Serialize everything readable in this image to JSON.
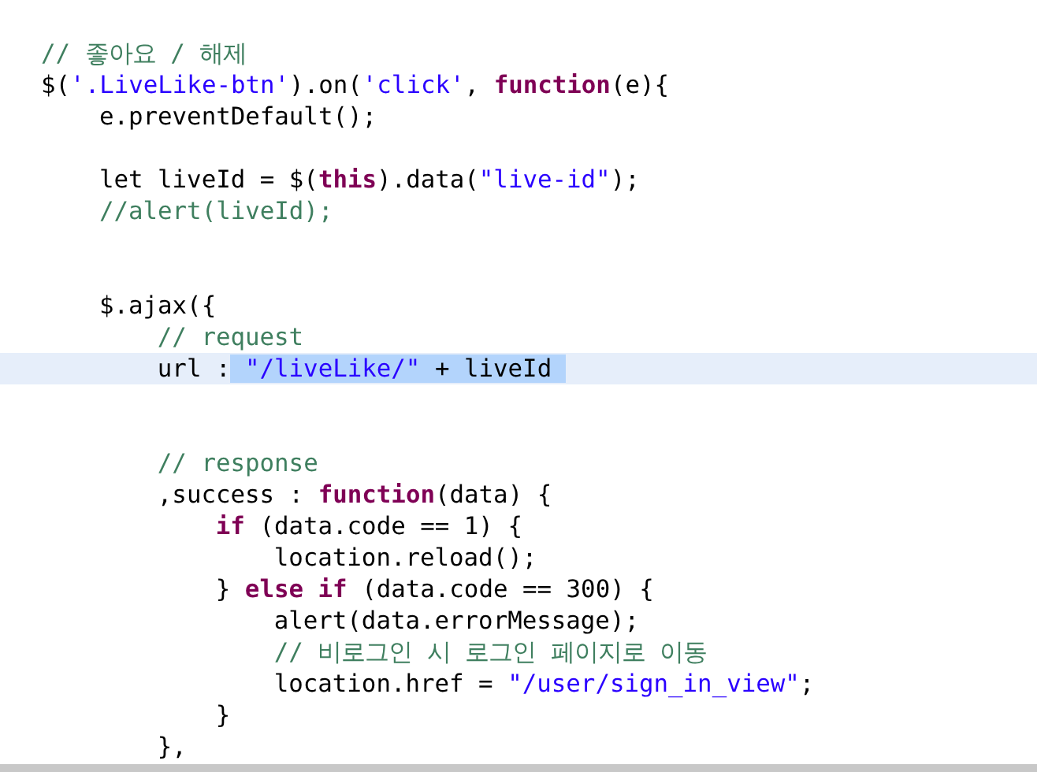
{
  "editor": {
    "lines": [
      {
        "current": false,
        "tokens": [
          {
            "text": "// 좋아요 / 해제",
            "kind": "comment",
            "selected": false
          }
        ]
      },
      {
        "current": false,
        "tokens": [
          {
            "text": "$(",
            "kind": "plain",
            "selected": false
          },
          {
            "text": "'.LiveLike-btn'",
            "kind": "string",
            "selected": false
          },
          {
            "text": ").on(",
            "kind": "plain",
            "selected": false
          },
          {
            "text": "'click'",
            "kind": "string",
            "selected": false
          },
          {
            "text": ", ",
            "kind": "plain",
            "selected": false
          },
          {
            "text": "function",
            "kind": "keyword",
            "selected": false
          },
          {
            "text": "(e){",
            "kind": "plain",
            "selected": false
          }
        ],
        "children": [
          {
            "current": false,
            "tokens": [
              {
                "text": "e.preventDefault();",
                "kind": "plain",
                "selected": false
              }
            ]
          },
          {
            "current": false
          },
          {
            "current": false,
            "tokens": [
              {
                "text": "let liveId = $(",
                "kind": "plain",
                "selected": false
              },
              {
                "text": "this",
                "kind": "keyword",
                "selected": false
              },
              {
                "text": ").data(",
                "kind": "plain",
                "selected": false
              },
              {
                "text": "\"live-id\"",
                "kind": "string",
                "selected": false
              },
              {
                "text": ");",
                "kind": "plain",
                "selected": false
              }
            ]
          },
          {
            "current": false,
            "tokens": [
              {
                "text": "//alert(liveId);",
                "kind": "comment",
                "selected": false
              }
            ]
          },
          {
            "current": false
          },
          {
            "current": false
          },
          {
            "current": false,
            "tokens": [
              {
                "text": "$.ajax({",
                "kind": "plain",
                "selected": false
              }
            ],
            "children": [
              {
                "current": false,
                "tokens": [
                  {
                    "text": "// request",
                    "kind": "comment",
                    "selected": false
                  }
                ]
              },
              {
                "current": true,
                "tokens": [
                  {
                    "text": "url :",
                    "kind": "plain",
                    "selected": false
                  },
                  {
                    "text": "\"/liveLike/\"",
                    "kind": "string",
                    "selected": true
                  },
                  {
                    "text": " + liveId",
                    "kind": "plain",
                    "selected": true
                  }
                ]
              },
              {
                "current": false
              },
              {
                "current": false
              },
              {
                "current": false,
                "tokens": [
                  {
                    "text": "// response",
                    "kind": "comment",
                    "selected": false
                  }
                ]
              },
              {
                "current": false,
                "tokens": [
                  {
                    "text": ",success : ",
                    "kind": "plain",
                    "selected": false
                  },
                  {
                    "text": "function",
                    "kind": "keyword",
                    "selected": false
                  },
                  {
                    "text": "(data) {",
                    "kind": "plain",
                    "selected": false
                  }
                ],
                "children": [
                  {
                    "current": false,
                    "tokens": [
                      {
                        "text": "if",
                        "kind": "keyword",
                        "selected": false
                      },
                      {
                        "text": " (data.code == 1) {",
                        "kind": "plain",
                        "selected": false
                      }
                    ],
                    "children": [
                      {
                        "current": false,
                        "tokens": [
                          {
                            "text": "location.reload();",
                            "kind": "plain",
                            "selected": false
                          }
                        ]
                      }
                    ]
                  },
                  {
                    "current": false,
                    "tokens": [
                      {
                        "text": "} ",
                        "kind": "plain",
                        "selected": false
                      },
                      {
                        "text": "else if",
                        "kind": "keyword",
                        "selected": false
                      },
                      {
                        "text": " (data.code == 300) {",
                        "kind": "plain",
                        "selected": false
                      }
                    ],
                    "children": [
                      {
                        "current": false,
                        "tokens": [
                          {
                            "text": "alert(data.errorMessage);",
                            "kind": "plain",
                            "selected": false
                          }
                        ]
                      },
                      {
                        "current": false,
                        "tokens": [
                          {
                            "text": "// 비로그인 시 로그인 페이지로 이동",
                            "kind": "comment",
                            "selected": false
                          }
                        ]
                      },
                      {
                        "current": false,
                        "tokens": [
                          {
                            "text": "location.href = ",
                            "kind": "plain",
                            "selected": false
                          },
                          {
                            "text": "\"/user/sign_in_view\"",
                            "kind": "string",
                            "selected": false
                          },
                          {
                            "text": ";",
                            "kind": "plain",
                            "selected": false
                          }
                        ]
                      }
                    ]
                  },
                  {
                    "current": false,
                    "tokens": [
                      {
                        "text": "}",
                        "kind": "plain",
                        "selected": false
                      }
                    ]
                  }
                ]
              },
              {
                "current": false,
                "tokens": [
                  {
                    "text": "},",
                    "kind": "plain",
                    "selected": false
                  }
                ]
              }
            ]
          }
        ]
      }
    ]
  }
}
